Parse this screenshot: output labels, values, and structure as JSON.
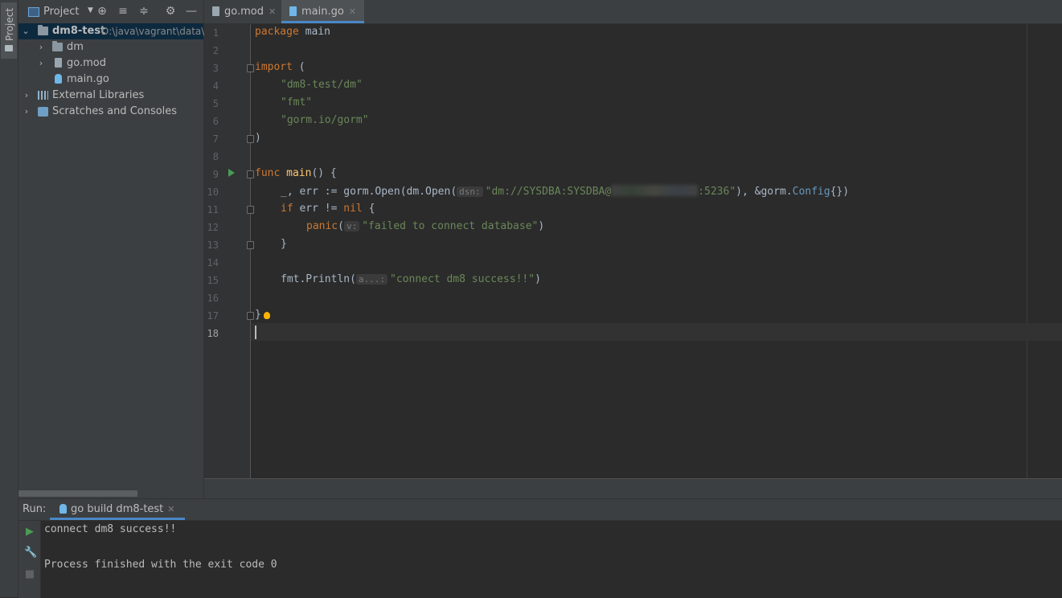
{
  "sidebar_strip": {
    "label": "Project"
  },
  "project_panel": {
    "title": "Project",
    "tree": [
      {
        "name": "dm8-test",
        "path": "D:\\java\\vagrant\\data\\"
      },
      {
        "name": "dm"
      },
      {
        "name": "go.mod"
      },
      {
        "name": "main.go"
      },
      {
        "name": "External Libraries"
      },
      {
        "name": "Scratches and Consoles"
      }
    ]
  },
  "tabs": [
    {
      "label": "go.mod"
    },
    {
      "label": "main.go"
    }
  ],
  "line_numbers": [
    "1",
    "2",
    "3",
    "4",
    "5",
    "6",
    "7",
    "8",
    "9",
    "10",
    "11",
    "12",
    "13",
    "14",
    "15",
    "16",
    "17",
    "18"
  ],
  "code": {
    "l1": {
      "kw": "package",
      "name": "main"
    },
    "l3": {
      "kw": "import",
      "rest": " ("
    },
    "l4": "\"dm8-test/dm\"",
    "l5": "\"fmt\"",
    "l6": "\"gorm.io/gorm\"",
    "l7": ")",
    "l9": {
      "kw": "func",
      "fn": "main",
      "rest": "() {"
    },
    "l10": {
      "pre": "_, err := gorm.Open(dm.Open(",
      "hint": "dsn:",
      "str_a": "\"dm://SYSDBA:SYSDBA@",
      "str_b": ":5236\"",
      "post1": "), &gorm.",
      "cfg": "Config",
      "post2": "{})"
    },
    "l11": {
      "kw": "if",
      "mid": " err != ",
      "nil": "nil",
      "rest": " {"
    },
    "l12": {
      "fn": "panic",
      "open": "(",
      "hint": "v:",
      "str": "\"failed to connect database\"",
      "close": ")"
    },
    "l13": "}",
    "l15": {
      "pre": "fmt.Println(",
      "hint": "a...:",
      "str": "\"connect dm8 success!!\"",
      "close": ")"
    },
    "l17": "}"
  },
  "run_panel": {
    "label": "Run:",
    "tab": "go build dm8-test",
    "output": [
      "connect dm8 success!!",
      "",
      "Process finished with the exit code 0"
    ]
  },
  "colors": {
    "keyword": "#cc7832",
    "string": "#6a8759",
    "function": "#ffc66d",
    "accent": "#4a88c7"
  }
}
